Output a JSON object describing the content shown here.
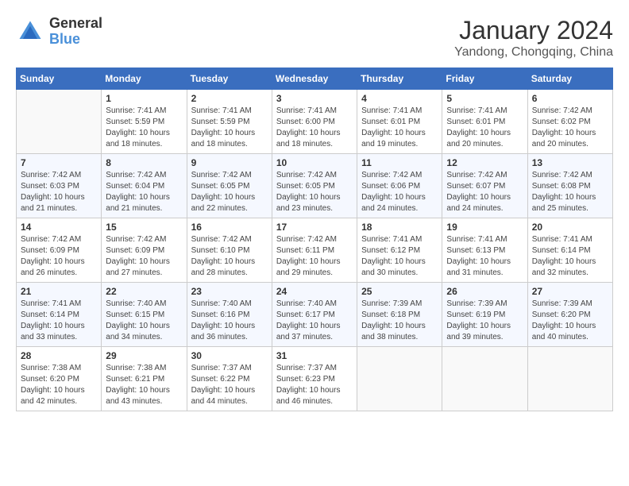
{
  "logo": {
    "general": "General",
    "blue": "Blue"
  },
  "header": {
    "month": "January 2024",
    "location": "Yandong, Chongqing, China"
  },
  "weekdays": [
    "Sunday",
    "Monday",
    "Tuesday",
    "Wednesday",
    "Thursday",
    "Friday",
    "Saturday"
  ],
  "weeks": [
    [
      {
        "day": "",
        "sunrise": "",
        "sunset": "",
        "daylight": ""
      },
      {
        "day": "1",
        "sunrise": "Sunrise: 7:41 AM",
        "sunset": "Sunset: 5:59 PM",
        "daylight": "Daylight: 10 hours and 18 minutes."
      },
      {
        "day": "2",
        "sunrise": "Sunrise: 7:41 AM",
        "sunset": "Sunset: 5:59 PM",
        "daylight": "Daylight: 10 hours and 18 minutes."
      },
      {
        "day": "3",
        "sunrise": "Sunrise: 7:41 AM",
        "sunset": "Sunset: 6:00 PM",
        "daylight": "Daylight: 10 hours and 18 minutes."
      },
      {
        "day": "4",
        "sunrise": "Sunrise: 7:41 AM",
        "sunset": "Sunset: 6:01 PM",
        "daylight": "Daylight: 10 hours and 19 minutes."
      },
      {
        "day": "5",
        "sunrise": "Sunrise: 7:41 AM",
        "sunset": "Sunset: 6:01 PM",
        "daylight": "Daylight: 10 hours and 20 minutes."
      },
      {
        "day": "6",
        "sunrise": "Sunrise: 7:42 AM",
        "sunset": "Sunset: 6:02 PM",
        "daylight": "Daylight: 10 hours and 20 minutes."
      }
    ],
    [
      {
        "day": "7",
        "sunrise": "Sunrise: 7:42 AM",
        "sunset": "Sunset: 6:03 PM",
        "daylight": "Daylight: 10 hours and 21 minutes."
      },
      {
        "day": "8",
        "sunrise": "Sunrise: 7:42 AM",
        "sunset": "Sunset: 6:04 PM",
        "daylight": "Daylight: 10 hours and 21 minutes."
      },
      {
        "day": "9",
        "sunrise": "Sunrise: 7:42 AM",
        "sunset": "Sunset: 6:05 PM",
        "daylight": "Daylight: 10 hours and 22 minutes."
      },
      {
        "day": "10",
        "sunrise": "Sunrise: 7:42 AM",
        "sunset": "Sunset: 6:05 PM",
        "daylight": "Daylight: 10 hours and 23 minutes."
      },
      {
        "day": "11",
        "sunrise": "Sunrise: 7:42 AM",
        "sunset": "Sunset: 6:06 PM",
        "daylight": "Daylight: 10 hours and 24 minutes."
      },
      {
        "day": "12",
        "sunrise": "Sunrise: 7:42 AM",
        "sunset": "Sunset: 6:07 PM",
        "daylight": "Daylight: 10 hours and 24 minutes."
      },
      {
        "day": "13",
        "sunrise": "Sunrise: 7:42 AM",
        "sunset": "Sunset: 6:08 PM",
        "daylight": "Daylight: 10 hours and 25 minutes."
      }
    ],
    [
      {
        "day": "14",
        "sunrise": "Sunrise: 7:42 AM",
        "sunset": "Sunset: 6:09 PM",
        "daylight": "Daylight: 10 hours and 26 minutes."
      },
      {
        "day": "15",
        "sunrise": "Sunrise: 7:42 AM",
        "sunset": "Sunset: 6:09 PM",
        "daylight": "Daylight: 10 hours and 27 minutes."
      },
      {
        "day": "16",
        "sunrise": "Sunrise: 7:42 AM",
        "sunset": "Sunset: 6:10 PM",
        "daylight": "Daylight: 10 hours and 28 minutes."
      },
      {
        "day": "17",
        "sunrise": "Sunrise: 7:42 AM",
        "sunset": "Sunset: 6:11 PM",
        "daylight": "Daylight: 10 hours and 29 minutes."
      },
      {
        "day": "18",
        "sunrise": "Sunrise: 7:41 AM",
        "sunset": "Sunset: 6:12 PM",
        "daylight": "Daylight: 10 hours and 30 minutes."
      },
      {
        "day": "19",
        "sunrise": "Sunrise: 7:41 AM",
        "sunset": "Sunset: 6:13 PM",
        "daylight": "Daylight: 10 hours and 31 minutes."
      },
      {
        "day": "20",
        "sunrise": "Sunrise: 7:41 AM",
        "sunset": "Sunset: 6:14 PM",
        "daylight": "Daylight: 10 hours and 32 minutes."
      }
    ],
    [
      {
        "day": "21",
        "sunrise": "Sunrise: 7:41 AM",
        "sunset": "Sunset: 6:14 PM",
        "daylight": "Daylight: 10 hours and 33 minutes."
      },
      {
        "day": "22",
        "sunrise": "Sunrise: 7:40 AM",
        "sunset": "Sunset: 6:15 PM",
        "daylight": "Daylight: 10 hours and 34 minutes."
      },
      {
        "day": "23",
        "sunrise": "Sunrise: 7:40 AM",
        "sunset": "Sunset: 6:16 PM",
        "daylight": "Daylight: 10 hours and 36 minutes."
      },
      {
        "day": "24",
        "sunrise": "Sunrise: 7:40 AM",
        "sunset": "Sunset: 6:17 PM",
        "daylight": "Daylight: 10 hours and 37 minutes."
      },
      {
        "day": "25",
        "sunrise": "Sunrise: 7:39 AM",
        "sunset": "Sunset: 6:18 PM",
        "daylight": "Daylight: 10 hours and 38 minutes."
      },
      {
        "day": "26",
        "sunrise": "Sunrise: 7:39 AM",
        "sunset": "Sunset: 6:19 PM",
        "daylight": "Daylight: 10 hours and 39 minutes."
      },
      {
        "day": "27",
        "sunrise": "Sunrise: 7:39 AM",
        "sunset": "Sunset: 6:20 PM",
        "daylight": "Daylight: 10 hours and 40 minutes."
      }
    ],
    [
      {
        "day": "28",
        "sunrise": "Sunrise: 7:38 AM",
        "sunset": "Sunset: 6:20 PM",
        "daylight": "Daylight: 10 hours and 42 minutes."
      },
      {
        "day": "29",
        "sunrise": "Sunrise: 7:38 AM",
        "sunset": "Sunset: 6:21 PM",
        "daylight": "Daylight: 10 hours and 43 minutes."
      },
      {
        "day": "30",
        "sunrise": "Sunrise: 7:37 AM",
        "sunset": "Sunset: 6:22 PM",
        "daylight": "Daylight: 10 hours and 44 minutes."
      },
      {
        "day": "31",
        "sunrise": "Sunrise: 7:37 AM",
        "sunset": "Sunset: 6:23 PM",
        "daylight": "Daylight: 10 hours and 46 minutes."
      },
      {
        "day": "",
        "sunrise": "",
        "sunset": "",
        "daylight": ""
      },
      {
        "day": "",
        "sunrise": "",
        "sunset": "",
        "daylight": ""
      },
      {
        "day": "",
        "sunrise": "",
        "sunset": "",
        "daylight": ""
      }
    ]
  ]
}
